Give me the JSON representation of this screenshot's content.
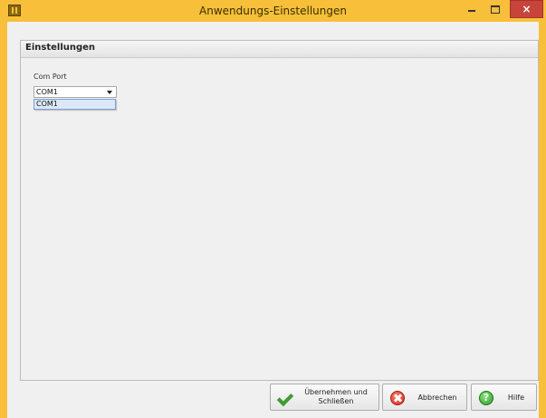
{
  "window": {
    "title": "Anwendungs-Einstellungen",
    "close_label": "×"
  },
  "panel": {
    "title": "Einstellungen",
    "com_port_label": "Com Port",
    "com_port_value": "COM1",
    "dropdown_options": [
      "COM1"
    ]
  },
  "buttons": {
    "apply_label": "Übernehmen und\nSchließen",
    "cancel_label": "Abbrechen",
    "help_label": "Hilfe"
  },
  "icons": {
    "help_glyph": "?"
  },
  "colors": {
    "titlebar": "#f7bf3a",
    "close_button": "#c7443a",
    "panel_bg": "#f0f0f0",
    "dropdown_highlight": "#dce8f7"
  }
}
